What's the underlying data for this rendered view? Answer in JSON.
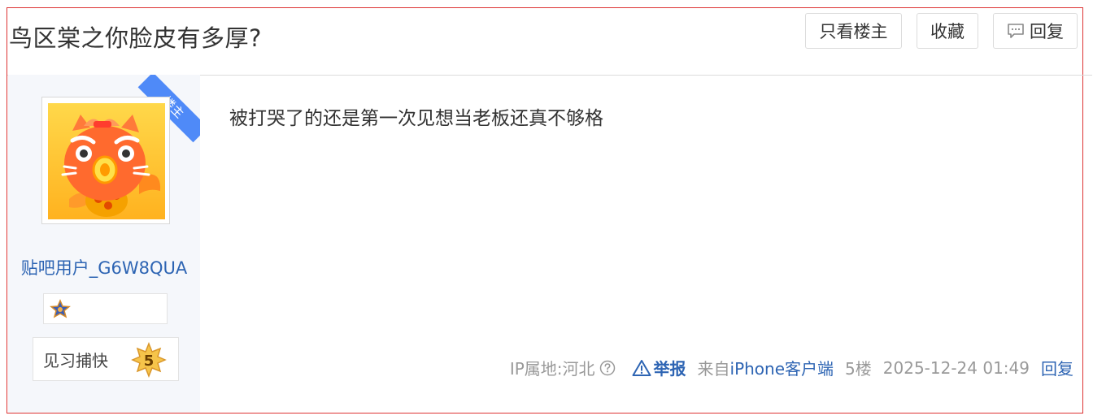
{
  "thread": {
    "title": "鸟区棠之你脸皮有多厚?",
    "buttons": {
      "only_op": "只看楼主",
      "favorite": "收藏",
      "reply": "回复"
    }
  },
  "post": {
    "op_ribbon": "楼主",
    "author": {
      "username": "贴吧用户_G6W8QUA",
      "level_title": "见习捕快",
      "level": "5",
      "avatar_icon": "tiger-fish-avatar",
      "badge_icon": "star-medal-icon"
    },
    "content": "被打哭了的还是第一次见想当老板还真不够格",
    "footer": {
      "ip_location": "IP属地:河北",
      "report_label": "举报",
      "from_prefix": "来自",
      "client": "iPhone客户端",
      "floor": "5楼",
      "datetime": "2025-12-24 01:49",
      "reply_label": "回复"
    }
  },
  "colors": {
    "link_blue": "#2d64b3",
    "ribbon_blue": "#4f8af8",
    "sidebar_bg": "#f5f7fb",
    "frame_red": "#dd3333"
  }
}
